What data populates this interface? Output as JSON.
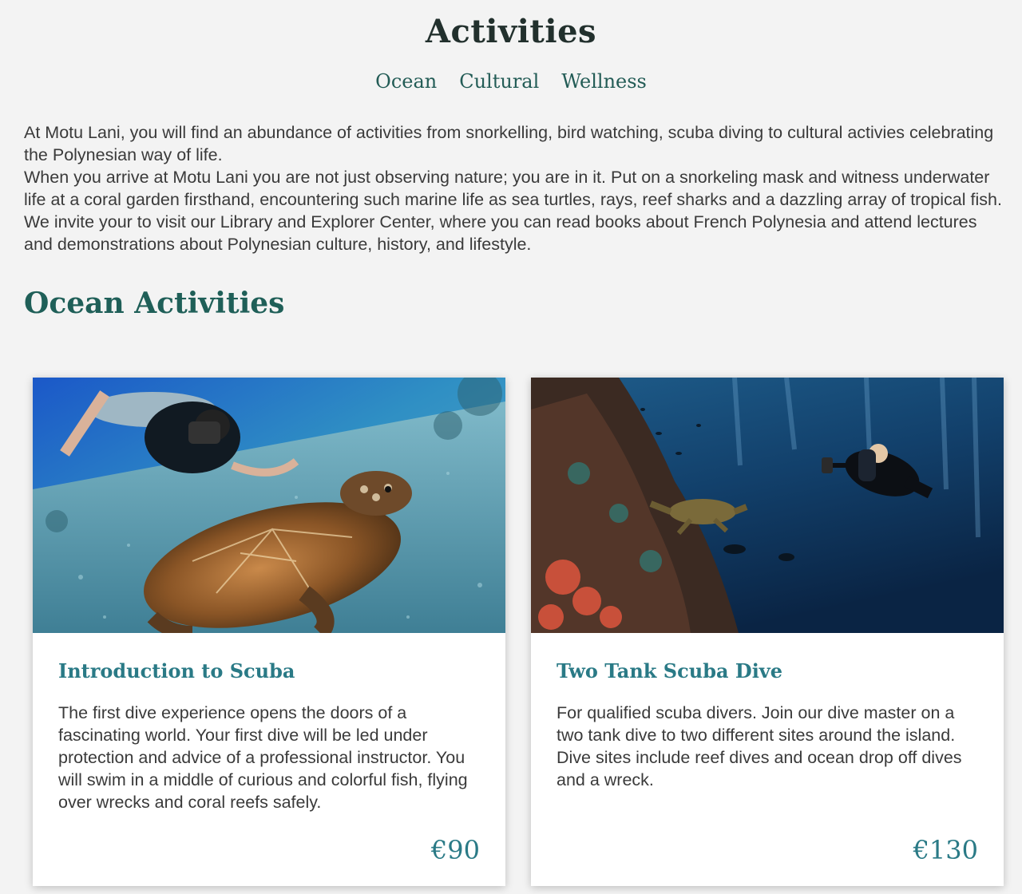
{
  "header": {
    "title": "Activities",
    "tabs": [
      {
        "label": "Ocean"
      },
      {
        "label": "Cultural"
      },
      {
        "label": "Wellness"
      }
    ]
  },
  "intro": {
    "paragraphs": [
      "At Motu Lani, you will find an abundance of activities from snorkelling, bird watching, scuba diving to cultural activies celebrating the Polynesian way of life.",
      "When you arrive at Motu Lani you are not just observing nature; you are in it. Put on a snorkeling mask and witness underwater life at a coral garden firsthand, encountering such marine life as sea turtles, rays, reef sharks and a dazzling array of tropical fish.",
      "We invite your to visit our Library and Explorer Center, where you can read books about French Polynesia and attend lectures and demonstrations about Polynesian culture, history, and lifestyle."
    ]
  },
  "section": {
    "title": "Ocean Activities"
  },
  "cards": [
    {
      "title": "Introduction to Scuba",
      "description": "The first dive experience opens the doors of a fascinating world. Your first dive will be led under protection and advice of a professional instructor. You will swim in a middle of curious and colorful fish, flying over wrecks and coral reefs safely.",
      "price": "€90",
      "image": "diver-with-sea-turtle-photo"
    },
    {
      "title": "Two Tank Scuba Dive",
      "description": "For qualified scuba divers. Join our dive master on a two tank dive to two different sites around the island. Dive sites include reef dives and ocean drop off dives and a wreck.",
      "price": "€130",
      "image": "diver-near-reef-wall-photo"
    }
  ],
  "colors": {
    "background": "#f3f3f3",
    "heading": "#22302d",
    "tab": "#235c56",
    "section_title": "#1f5f58",
    "card_accent": "#2a7a86"
  }
}
